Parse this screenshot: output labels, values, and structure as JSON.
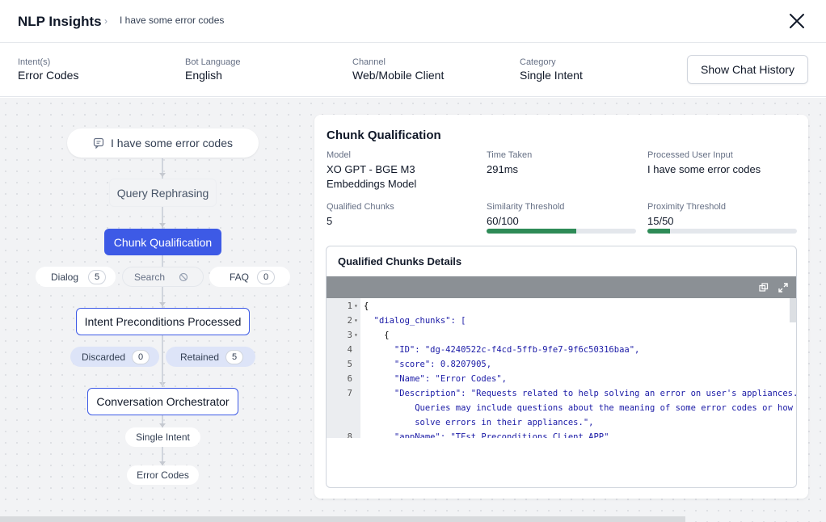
{
  "header": {
    "title": "NLP Insights",
    "crumb_sep": "›",
    "crumb": "I have some error codes"
  },
  "info": {
    "intent_label": "Intent(s)",
    "intent_value": "Error Codes",
    "language_label": "Bot Language",
    "language_value": "English",
    "channel_label": "Channel",
    "channel_value": "Web/Mobile Client",
    "category_label": "Category",
    "category_value": "Single Intent",
    "history_button": "Show Chat History"
  },
  "flow": {
    "user_input": "I have some error codes",
    "query_rephrasing": "Query Rephrasing",
    "chunk_qualification": "Chunk Qualification",
    "dialog_label": "Dialog",
    "dialog_count": "5",
    "search_label": "Search",
    "faq_label": "FAQ",
    "faq_count": "0",
    "intent_preconditions": "Intent Preconditions Processed",
    "discarded_label": "Discarded",
    "discarded_count": "0",
    "retained_label": "Retained",
    "retained_count": "5",
    "orchestrator": "Conversation Orchestrator",
    "single_intent": "Single Intent",
    "error_codes": "Error Codes"
  },
  "card": {
    "title": "Chunk Qualification",
    "model_label": "Model",
    "model_value_1": "XO GPT - BGE M3",
    "model_value_2": "Embeddings Model",
    "time_label": "Time Taken",
    "time_value": "291ms",
    "input_label": "Processed User Input",
    "input_value": "I have some error codes",
    "qualified_label": "Qualified Chunks",
    "qualified_value": "5",
    "similarity_label": "Similarity Threshold",
    "similarity_value": "60/100",
    "similarity_fraction": 0.6,
    "proximity_label": "Proximity Threshold",
    "proximity_value": "15/50",
    "proximity_fraction": 0.15,
    "details_title": "Qualified Chunks Details"
  },
  "code": {
    "lines": [
      {
        "n": "1",
        "fold": "▾",
        "text": "{"
      },
      {
        "n": "2",
        "fold": "▾",
        "text": "  \"dialog_chunks\": ["
      },
      {
        "n": "3",
        "fold": "▾",
        "text": "    {"
      },
      {
        "n": "4",
        "fold": "",
        "text": "      \"ID\": \"dg-4240522c-f4cd-5ffb-9fe7-9f6c50316baa\","
      },
      {
        "n": "5",
        "fold": "",
        "text": "      \"score\": 0.8207905,"
      },
      {
        "n": "6",
        "fold": "",
        "text": "      \"Name\": \"Error Codes\","
      },
      {
        "n": "7",
        "fold": "",
        "text": "      \"Description\": \"Requests related to help solving an error on user's appliances."
      },
      {
        "n": "",
        "fold": "",
        "text": "          Queries may include questions about the meaning of some error codes or how to"
      },
      {
        "n": "",
        "fold": "",
        "text": "          solve errors in their appliances.\","
      },
      {
        "n": "8",
        "fold": "",
        "text": "      \"appName\": \"TEst Preconditions CLient APP\","
      }
    ]
  }
}
